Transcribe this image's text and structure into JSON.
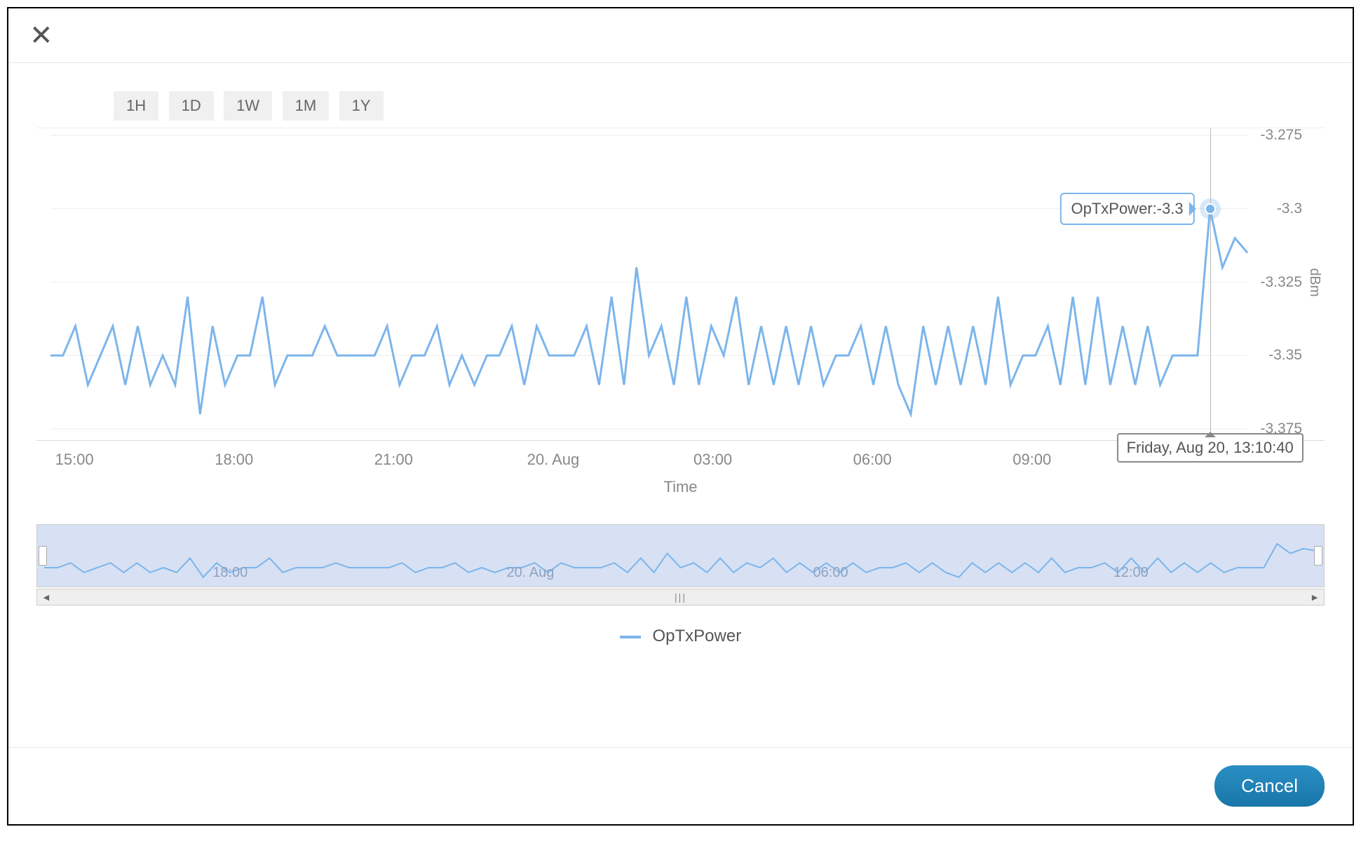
{
  "controls": {
    "close_label": "✕",
    "cancel_label": "Cancel",
    "time_ranges": [
      "1H",
      "1D",
      "1W",
      "1M",
      "1Y"
    ]
  },
  "tooltip": {
    "series_label": "OpTxPower:",
    "value": "-3.3",
    "timestamp": "Friday, Aug 20, 13:10:40"
  },
  "legend": {
    "series_name": "OpTxPower"
  },
  "navigator": {
    "ticks": [
      "18:00",
      "20. Aug",
      "06:00",
      "12:00"
    ]
  },
  "chart_data": {
    "type": "line",
    "title": "",
    "xlabel": "Time",
    "ylabel": "dBm",
    "ylim": [
      -3.375,
      -3.275
    ],
    "y_ticks": [
      -3.275,
      -3.3,
      -3.325,
      -3.35,
      -3.375
    ],
    "x_ticks": [
      "15:00",
      "18:00",
      "21:00",
      "20. Aug",
      "03:00",
      "06:00",
      "09:00"
    ],
    "series": [
      {
        "name": "OpTxPower",
        "color": "#7cb5ec",
        "values": [
          -3.35,
          -3.35,
          -3.34,
          -3.36,
          -3.35,
          -3.34,
          -3.36,
          -3.34,
          -3.36,
          -3.35,
          -3.36,
          -3.33,
          -3.37,
          -3.34,
          -3.36,
          -3.35,
          -3.35,
          -3.33,
          -3.36,
          -3.35,
          -3.35,
          -3.35,
          -3.34,
          -3.35,
          -3.35,
          -3.35,
          -3.35,
          -3.34,
          -3.36,
          -3.35,
          -3.35,
          -3.34,
          -3.36,
          -3.35,
          -3.36,
          -3.35,
          -3.35,
          -3.34,
          -3.36,
          -3.34,
          -3.35,
          -3.35,
          -3.35,
          -3.34,
          -3.36,
          -3.33,
          -3.36,
          -3.32,
          -3.35,
          -3.34,
          -3.36,
          -3.33,
          -3.36,
          -3.34,
          -3.35,
          -3.33,
          -3.36,
          -3.34,
          -3.36,
          -3.34,
          -3.36,
          -3.34,
          -3.36,
          -3.35,
          -3.35,
          -3.34,
          -3.36,
          -3.34,
          -3.36,
          -3.37,
          -3.34,
          -3.36,
          -3.34,
          -3.36,
          -3.34,
          -3.36,
          -3.33,
          -3.36,
          -3.35,
          -3.35,
          -3.34,
          -3.36,
          -3.33,
          -3.36,
          -3.33,
          -3.36,
          -3.34,
          -3.36,
          -3.34,
          -3.36,
          -3.35,
          -3.35,
          -3.35,
          -3.3,
          -3.32,
          -3.31,
          -3.315
        ]
      }
    ],
    "highlight_point": {
      "index": 93,
      "value": -3.3
    }
  }
}
